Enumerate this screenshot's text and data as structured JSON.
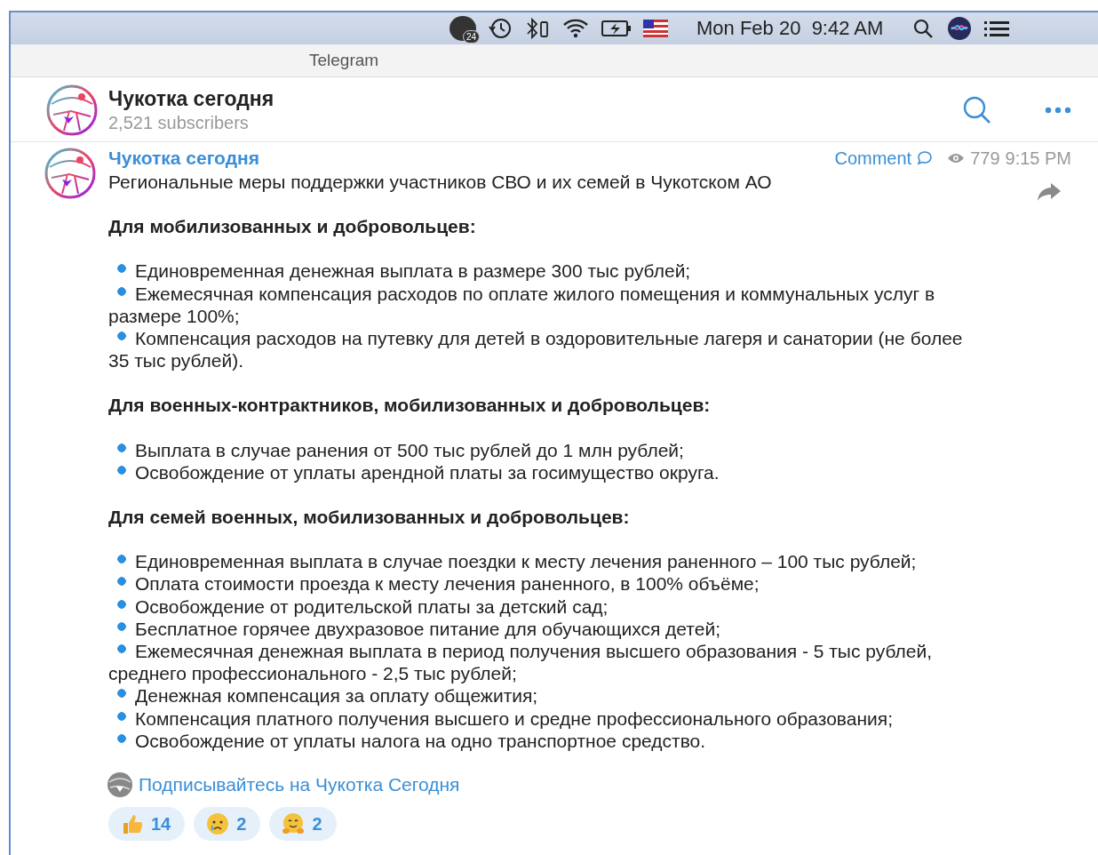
{
  "menu_bar": {
    "badge": "24",
    "clock": "Mon Feb 20  9:42 AM"
  },
  "window": {
    "title": "Telegram"
  },
  "channel": {
    "name": "Чукотка сегодня",
    "subscribers": "2,521 subscribers"
  },
  "message": {
    "author": "Чукотка сегодня",
    "comment": "Comment",
    "views": "779",
    "time": "9:15 PM",
    "lines": [
      {
        "kind": "text",
        "text": "Региональные меры поддержки участников СВО и их семей в Чукотском АО"
      },
      {
        "kind": "heading",
        "text": "Для мобилизованных и добровольцев:"
      },
      {
        "kind": "bullet",
        "text": "Единовременная денежная выплата в размере 300 тыс рублей;"
      },
      {
        "kind": "bullet",
        "text": "Ежемесячная компенсация расходов по оплате жилого помещения и коммунальных услуг в размере 100%;"
      },
      {
        "kind": "bullet",
        "text": "Компенсация расходов на путевку для детей в оздоровительные лагеря и санатории (не более 35 тыс рублей)."
      },
      {
        "kind": "heading",
        "text": "Для военных-контрактников, мобилизованных и добровольцев:"
      },
      {
        "kind": "bullet",
        "text": "Выплата  в случае ранения от 500 тыс рублей до 1 млн рублей;"
      },
      {
        "kind": "bullet",
        "text": "Освобождение от уплаты арендной платы за госимущество округа."
      },
      {
        "kind": "heading",
        "text": "Для семей военных, мобилизованных и добровольцев:"
      },
      {
        "kind": "bullet",
        "text": "Единовременная выплата в случае поездки к месту лечения раненного – 100 тыс рублей;"
      },
      {
        "kind": "bullet",
        "text": "Оплата стоимости проезда к месту лечения раненного, в 100% объёме;"
      },
      {
        "kind": "bullet",
        "text": "Освобождение от родительской платы за детский сад;"
      },
      {
        "kind": "bullet",
        "text": "Бесплатное горячее двухразовое питание для обучающихся детей;"
      },
      {
        "kind": "bullet",
        "text": "Ежемесячная денежная выплата в период получения высшего образования - 5 тыс рублей, среднего профессионального - 2,5 тыс рублей;"
      },
      {
        "kind": "bullet",
        "text": "Денежная компенсация за оплату общежития;"
      },
      {
        "kind": "bullet",
        "text": "Компенсация платного получения высшего и средне профессионального образования;"
      },
      {
        "kind": "bullet",
        "text": "Освобождение от уплаты налога на одно транспортное средство."
      }
    ],
    "link": "Подписывайтесь на Чукотка Сегодня",
    "reactions": [
      {
        "kind": "thumbs_up",
        "count": "14"
      },
      {
        "kind": "crying",
        "count": "2"
      },
      {
        "kind": "hugging",
        "count": "2"
      }
    ]
  }
}
